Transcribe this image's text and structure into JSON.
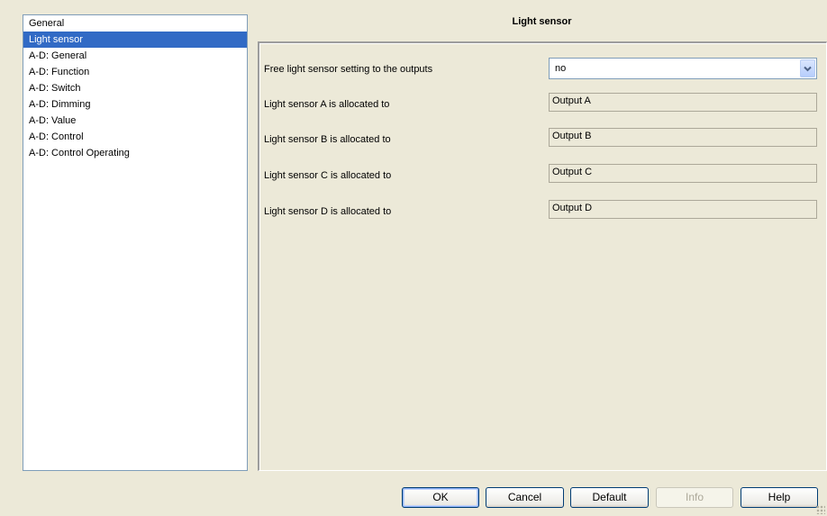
{
  "sidebar": {
    "items": [
      {
        "label": "General"
      },
      {
        "label": "Light sensor"
      },
      {
        "label": "A-D: General"
      },
      {
        "label": "A-D: Function"
      },
      {
        "label": "A-D: Switch"
      },
      {
        "label": "A-D: Dimming"
      },
      {
        "label": "A-D: Value"
      },
      {
        "label": "A-D: Control"
      },
      {
        "label": "A-D: Control Operating"
      }
    ],
    "selected_index": 1
  },
  "panel": {
    "title": "Light sensor",
    "free_setting": {
      "label": "Free light sensor setting to the outputs",
      "value": "no"
    },
    "rows": [
      {
        "label": "Light sensor A is allocated to",
        "value": "Output A"
      },
      {
        "label": "Light sensor B is allocated to",
        "value": "Output B"
      },
      {
        "label": "Light sensor C is allocated to",
        "value": "Output C"
      },
      {
        "label": "Light sensor D is allocated to",
        "value": "Output D"
      }
    ]
  },
  "buttons": {
    "ok": "OK",
    "cancel": "Cancel",
    "default": "Default",
    "info": "Info",
    "help": "Help"
  },
  "colors": {
    "selection": "#316ac5",
    "dialog_background": "#ece9d8"
  },
  "icons": {
    "combo_arrow": "chevron-down-icon",
    "resize": "resize-grip-icon"
  }
}
